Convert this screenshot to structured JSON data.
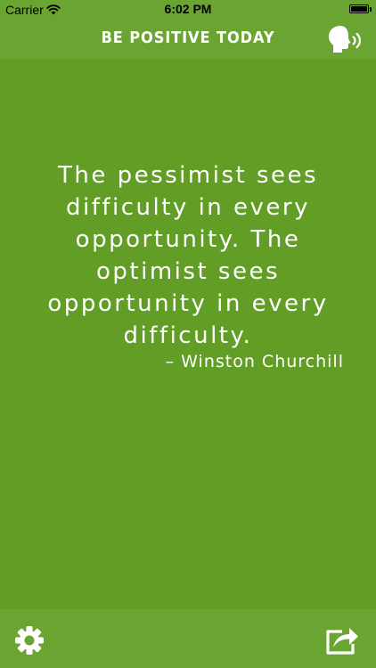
{
  "status_bar": {
    "carrier": "Carrier",
    "time": "6:02 PM",
    "wifi_icon": "wifi-icon",
    "battery_icon": "battery-icon"
  },
  "nav": {
    "title": "BE POSITIVE TODAY",
    "speak_icon": "speaking-head-icon"
  },
  "quote": {
    "text": "The pessimist sees difficulty in every opportunity. The optimist sees opportunity in every difficulty.",
    "author": "– Winston Churchill"
  },
  "toolbar": {
    "settings_icon": "gear-icon",
    "share_icon": "share-icon"
  },
  "colors": {
    "background": "#629d26",
    "bars": "#6aa531",
    "text": "#ffffff"
  }
}
